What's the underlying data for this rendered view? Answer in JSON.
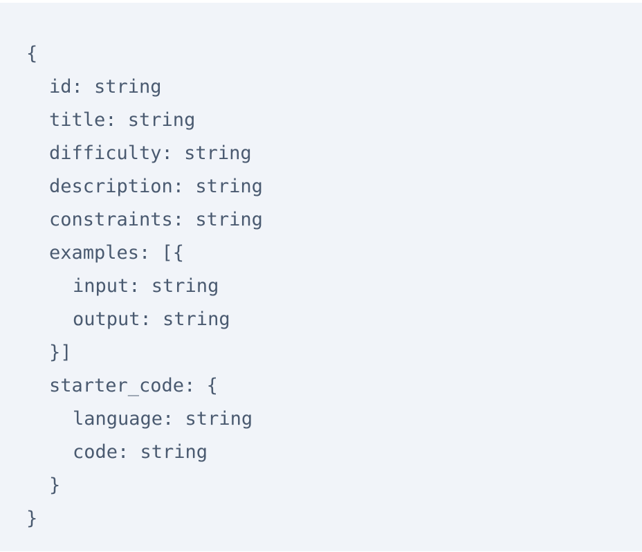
{
  "code": {
    "lines": [
      "{",
      "id: string",
      "title: string",
      "difficulty: string",
      "description: string",
      "constraints: string",
      "examples: [{",
      "input: string",
      "output: string",
      "}]",
      "starter_code: {",
      "language: string",
      "code: string",
      "}",
      "}"
    ]
  },
  "colors": {
    "background": "#f1f4f9",
    "text": "#4a5a70"
  }
}
